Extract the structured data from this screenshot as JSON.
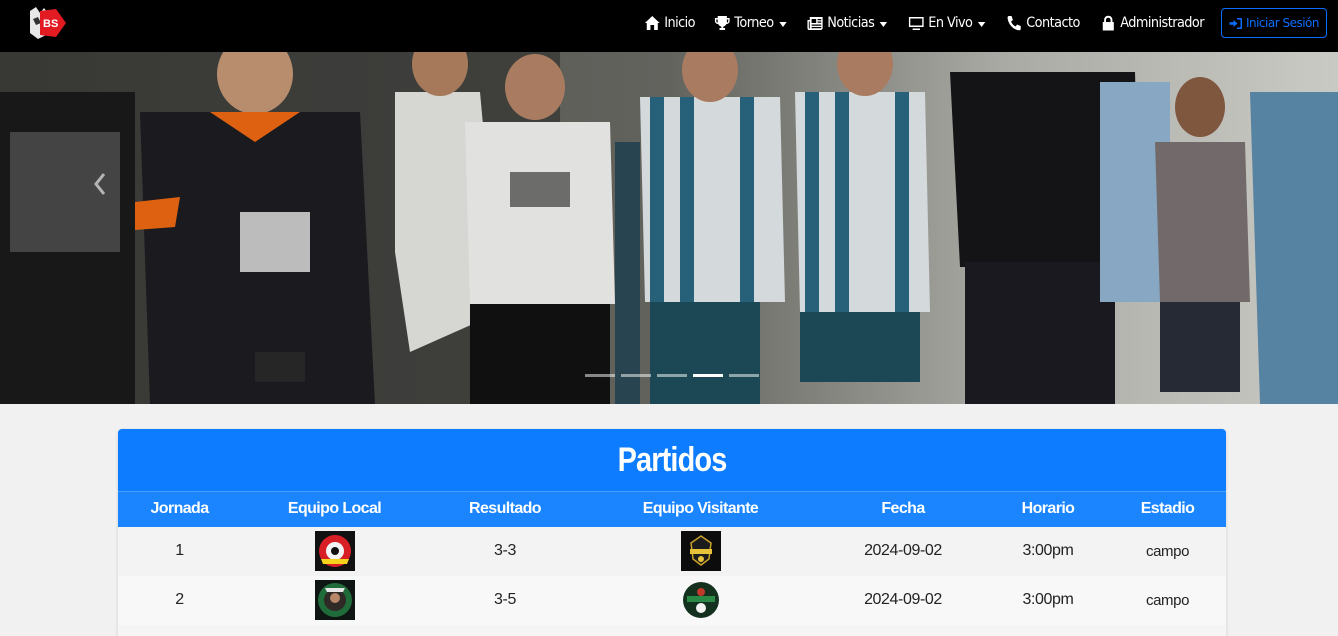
{
  "brand": {
    "logo_text": "BS"
  },
  "nav": {
    "items": [
      {
        "label": "Inicio",
        "icon": "home-icon",
        "dropdown": false
      },
      {
        "label": "Torneo",
        "icon": "trophy-icon",
        "dropdown": true
      },
      {
        "label": "Noticias",
        "icon": "newspaper-icon",
        "dropdown": true
      },
      {
        "label": "En Vivo",
        "icon": "tv-icon",
        "dropdown": true
      },
      {
        "label": "Contacto",
        "icon": "phone-icon",
        "dropdown": false
      },
      {
        "label": "Administrador",
        "icon": "lock-icon",
        "dropdown": false
      }
    ],
    "login_label": "Iniciar Sesión",
    "login_icon": "sign-in-icon"
  },
  "carousel": {
    "slides": 5,
    "active_index": 3
  },
  "matches": {
    "title": "Partidos",
    "columns": [
      "Jornada",
      "Equipo Local",
      "Resultado",
      "Equipo Visitante",
      "Fecha",
      "Horario",
      "Estadio"
    ],
    "rows": [
      {
        "jornada": "1",
        "local_logo": "team-logo-red",
        "resultado": "3-3",
        "visitante_logo": "team-logo-mineros",
        "fecha": "2024-09-02",
        "horario": "3:00pm",
        "estadio": "campo"
      },
      {
        "jornada": "2",
        "local_logo": "team-logo-green",
        "resultado": "3-5",
        "visitante_logo": "team-logo-green-ball",
        "fecha": "2024-09-02",
        "horario": "3:00pm",
        "estadio": "campo"
      }
    ]
  },
  "colors": {
    "primary": "#0d7cff",
    "navbar": "#000000",
    "login": "#0d6efd"
  }
}
